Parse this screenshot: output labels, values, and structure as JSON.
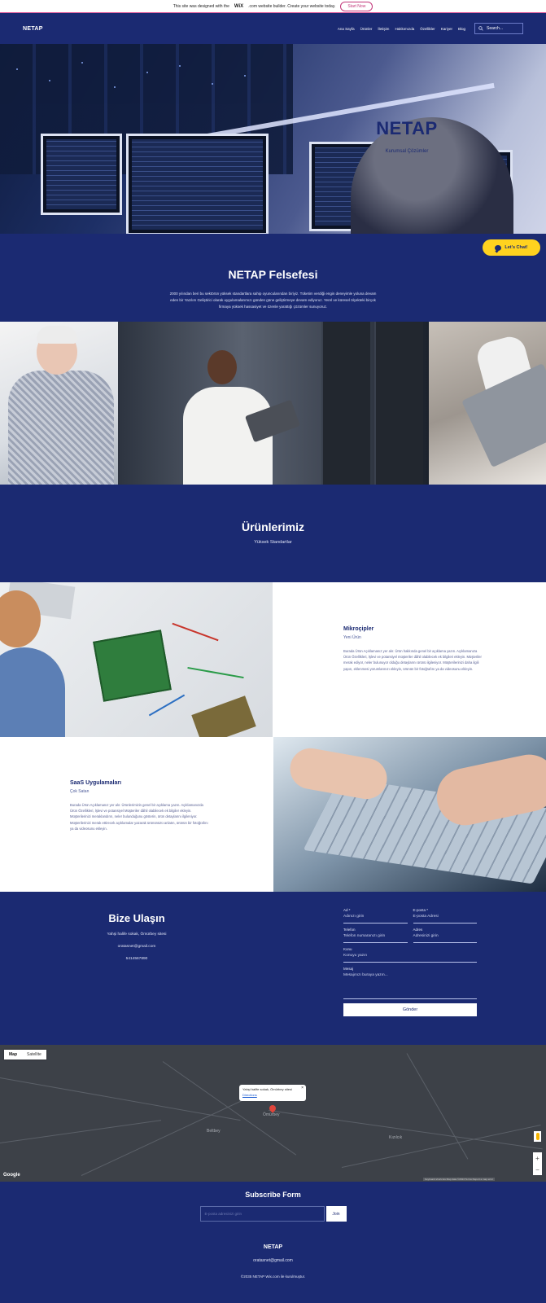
{
  "banner": {
    "text_before": "This site was designed with the",
    "wix": "WiX",
    "text_after": ".com website builder. Create your website today.",
    "button": "Start Now"
  },
  "header": {
    "logo": "NETAP",
    "nav": [
      "Ana Sayfa",
      "Ürünler",
      "İletişim",
      "Hakkımızda",
      "Özellikler",
      "Kariyer",
      "Blog"
    ],
    "search_placeholder": "Search..."
  },
  "hero": {
    "title": "NETAP",
    "subtitle": "Kurumsal Çözümler"
  },
  "chat": {
    "label": "Let's Chat!"
  },
  "philosophy": {
    "title": "NETAP Felsefesi",
    "text": "2000 yılından beri bu sektörün yüksek standartlara sahip oyuncularından biriyiz. Tüketim verdiği engin deneyimle yoluna devam eden bir Yazılım Geliştirici olarak uygulamalarımızı günden güne geliştirmeye devam ediyoruz. Yerel ve küresel ölçekteki birçok firmaya yüksek hassasiyet ve özenle yarattığı çözümler sunuyoruz."
  },
  "products": {
    "title": "Ürünlerimiz",
    "subtitle": "Yüksek Standartlar",
    "items": [
      {
        "name": "Mikroçipler",
        "tag": "Yeni Ürün",
        "desc": "Burada Ürün Açıklamanız yer alır. Ürün hakkında genel bir açıklama yazın. Açıklamanıza Ürün Özellikleri, İşlevi ve potansiyel müşteriler dâhil olabilecek ek bilgileri ekleyin. Müşteriler merak ediyor, neler bulunuyor olduğu detaylarını ürünü ilgileniyor. Müşterilerinizi daha ilgili yapın, eklenmesi yorumlarınızı ekleyin, ürünün bir fotoğrafını ya da videosunu ekleyin."
      },
      {
        "name": "SaaS Uygulamaları",
        "tag": "Çok Satan",
        "desc": "Burada Ürün Açıklamanız yer alır. Ürünlerimizin genel bir açıklama yazın. Açıklamanızda Ürün Özellikleri, İşlevi ve potansiyel Müşteriler dâhil olabilecek ek bilgiler ekleyin. Müşterilerinizi meraklandırın, neler bulunduğunu gösterin, ürün detaylarını ilgileniyor. Müşterilerinizi merak ettirecek açıklamalar yazarak ürününüzü anlatın, ürünün bir fotoğrafını ya da videosunu ekleyin."
      }
    ]
  },
  "contact": {
    "title": "Bize Ulaşın",
    "address": "Yahşi halife sokak, Ömürbey sitesi",
    "email": "oratasnet@gmail.com",
    "phone": "5414567890",
    "form": {
      "name_label": "Ad *",
      "name_placeholder": "Adınızı girin",
      "email_label": "E-posta *",
      "email_placeholder": "E-posta Adresi",
      "phone_label": "Telefon",
      "phone_placeholder": "Telefon numaranızı girin",
      "address_label": "Adres",
      "address_placeholder": "Adresinizi girin",
      "subject_label": "Konu",
      "subject_placeholder": "Konuyu yazın",
      "message_label": "Mesaj",
      "message_placeholder": "Mesajınızı buraya yazın...",
      "submit": "Gönder"
    }
  },
  "map": {
    "tab_map": "Map",
    "tab_satellite": "Satellite",
    "info_text": "Yahşi halife sokak, Ömürbey sitesi",
    "info_link": "Directions",
    "labels": [
      "Ömürbey",
      "Beltbey",
      "Kızılcık"
    ],
    "google": "Google",
    "attribution": "Keyboard shortcuts   Map data ©2024   Terms   Report a map error"
  },
  "subscribe": {
    "title": "Subscribe Form",
    "placeholder": "E-posta adresinizi girin",
    "button": "Join"
  },
  "footer": {
    "logo": "NETAP",
    "email": "oratasnet@gmail.com",
    "copyright": "©2035 NETAP Wix.com ile kurulmuştur."
  }
}
